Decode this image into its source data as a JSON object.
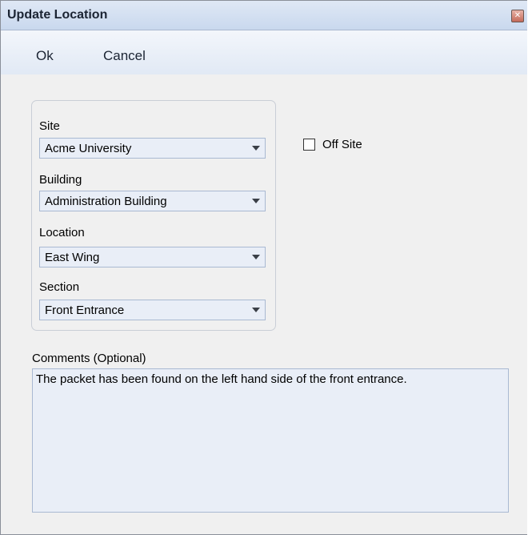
{
  "window": {
    "title": "Update Location",
    "close_icon": "close-icon"
  },
  "toolbar": {
    "ok_label": "Ok",
    "cancel_label": "Cancel"
  },
  "fields": {
    "site": {
      "label": "Site",
      "value": "Acme University"
    },
    "building": {
      "label": "Building",
      "value": "Administration Building"
    },
    "location": {
      "label": "Location",
      "value": "East Wing"
    },
    "section": {
      "label": "Section",
      "value": "Front Entrance"
    }
  },
  "off_site": {
    "label": "Off Site",
    "checked": false
  },
  "comments": {
    "label": "Comments (Optional)",
    "value": "The packet has been found on the left hand side of the front entrance."
  }
}
